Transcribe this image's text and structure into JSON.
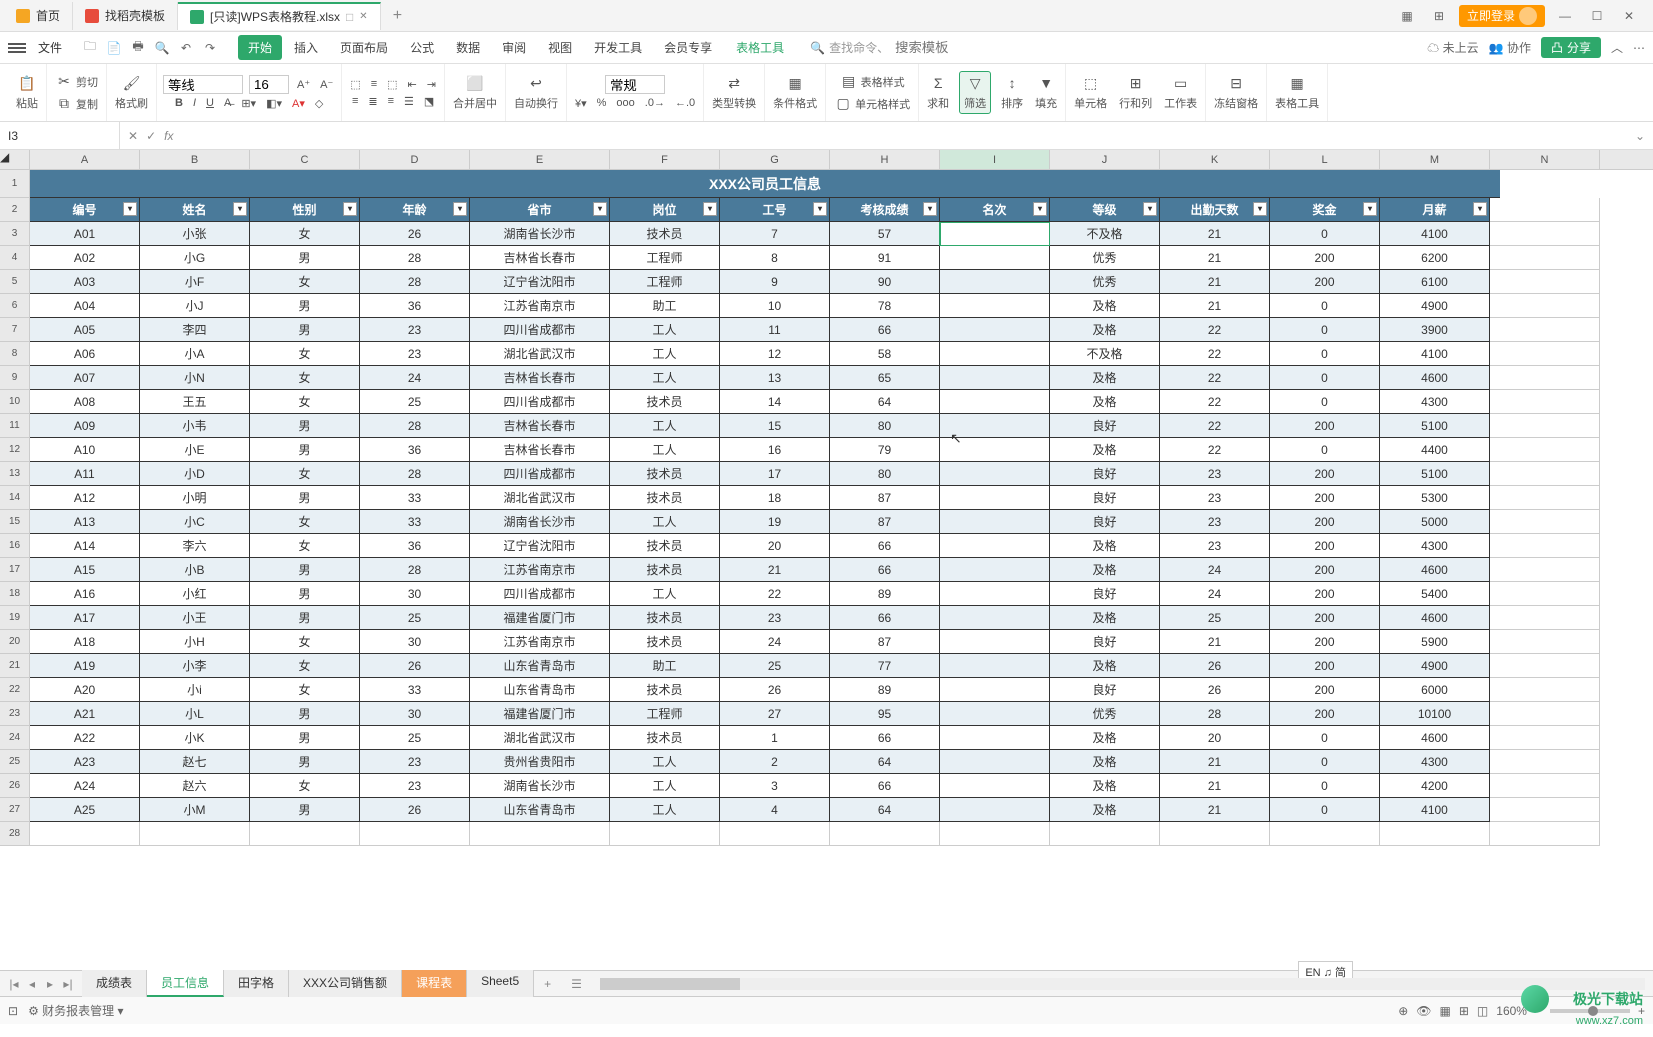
{
  "topTabs": [
    {
      "label": "首页",
      "icon": "home"
    },
    {
      "label": "找稻壳模板",
      "icon": "doc"
    },
    {
      "label": "[只读]WPS表格教程.xlsx",
      "icon": "sheet",
      "active": true,
      "badge": "□"
    }
  ],
  "login": "立即登录",
  "fileMenu": "文件",
  "menuTabs": [
    "开始",
    "插入",
    "页面布局",
    "公式",
    "数据",
    "审阅",
    "视图",
    "开发工具",
    "会员专享"
  ],
  "menuSpecial": "表格工具",
  "searchHint": "查找命令、",
  "searchPlaceholder": "搜索模板",
  "cloud": "未上云",
  "collab": "协作",
  "share": "分享",
  "clipboard": {
    "paste": "粘贴",
    "cut": "剪切",
    "copy": "复制",
    "format": "格式刷"
  },
  "font": {
    "name": "等线",
    "size": "16"
  },
  "fmt": {
    "B": "B",
    "I": "I",
    "U": "U"
  },
  "align": {
    "merge": "合并居中",
    "wrap": "自动换行"
  },
  "number": {
    "fmt": "常规",
    "type": "类型转换"
  },
  "cond": "条件格式",
  "tablefmt": "表格样式",
  "cellfmt": "单元格样式",
  "calc": "求和",
  "filter": "筛选",
  "sort": "排序",
  "fill": "填充",
  "cell": "单元格",
  "rowcol": "行和列",
  "sheet": "工作表",
  "freeze": "冻结窗格",
  "tools": "表格工具",
  "cellRef": "I3",
  "fx": "fx",
  "title": "XXX公司员工信息",
  "headers": [
    "编号",
    "姓名",
    "性别",
    "年龄",
    "省市",
    "岗位",
    "工号",
    "考核成绩",
    "名次",
    "等级",
    "出勤天数",
    "奖金",
    "月薪"
  ],
  "colLetters": [
    "A",
    "B",
    "C",
    "D",
    "E",
    "F",
    "G",
    "H",
    "I",
    "J",
    "K",
    "L",
    "M",
    "N"
  ],
  "rows": [
    [
      "A01",
      "小张",
      "女",
      "26",
      "湖南省长沙市",
      "技术员",
      "7",
      "57",
      "",
      "不及格",
      "21",
      "0",
      "4100"
    ],
    [
      "A02",
      "小G",
      "男",
      "28",
      "吉林省长春市",
      "工程师",
      "8",
      "91",
      "",
      "优秀",
      "21",
      "200",
      "6200"
    ],
    [
      "A03",
      "小F",
      "女",
      "28",
      "辽宁省沈阳市",
      "工程师",
      "9",
      "90",
      "",
      "优秀",
      "21",
      "200",
      "6100"
    ],
    [
      "A04",
      "小J",
      "男",
      "36",
      "江苏省南京市",
      "助工",
      "10",
      "78",
      "",
      "及格",
      "21",
      "0",
      "4900"
    ],
    [
      "A05",
      "李四",
      "男",
      "23",
      "四川省成都市",
      "工人",
      "11",
      "66",
      "",
      "及格",
      "22",
      "0",
      "3900"
    ],
    [
      "A06",
      "小A",
      "女",
      "23",
      "湖北省武汉市",
      "工人",
      "12",
      "58",
      "",
      "不及格",
      "22",
      "0",
      "4100"
    ],
    [
      "A07",
      "小N",
      "女",
      "24",
      "吉林省长春市",
      "工人",
      "13",
      "65",
      "",
      "及格",
      "22",
      "0",
      "4600"
    ],
    [
      "A08",
      "王五",
      "女",
      "25",
      "四川省成都市",
      "技术员",
      "14",
      "64",
      "",
      "及格",
      "22",
      "0",
      "4300"
    ],
    [
      "A09",
      "小韦",
      "男",
      "28",
      "吉林省长春市",
      "工人",
      "15",
      "80",
      "",
      "良好",
      "22",
      "200",
      "5100"
    ],
    [
      "A10",
      "小E",
      "男",
      "36",
      "吉林省长春市",
      "工人",
      "16",
      "79",
      "",
      "及格",
      "22",
      "0",
      "4400"
    ],
    [
      "A11",
      "小D",
      "女",
      "28",
      "四川省成都市",
      "技术员",
      "17",
      "80",
      "",
      "良好",
      "23",
      "200",
      "5100"
    ],
    [
      "A12",
      "小明",
      "男",
      "33",
      "湖北省武汉市",
      "技术员",
      "18",
      "87",
      "",
      "良好",
      "23",
      "200",
      "5300"
    ],
    [
      "A13",
      "小C",
      "女",
      "33",
      "湖南省长沙市",
      "工人",
      "19",
      "87",
      "",
      "良好",
      "23",
      "200",
      "5000"
    ],
    [
      "A14",
      "李六",
      "女",
      "36",
      "辽宁省沈阳市",
      "技术员",
      "20",
      "66",
      "",
      "及格",
      "23",
      "200",
      "4300"
    ],
    [
      "A15",
      "小B",
      "男",
      "28",
      "江苏省南京市",
      "技术员",
      "21",
      "66",
      "",
      "及格",
      "24",
      "200",
      "4600"
    ],
    [
      "A16",
      "小红",
      "男",
      "30",
      "四川省成都市",
      "工人",
      "22",
      "89",
      "",
      "良好",
      "24",
      "200",
      "5400"
    ],
    [
      "A17",
      "小王",
      "男",
      "25",
      "福建省厦门市",
      "技术员",
      "23",
      "66",
      "",
      "及格",
      "25",
      "200",
      "4600"
    ],
    [
      "A18",
      "小H",
      "女",
      "30",
      "江苏省南京市",
      "技术员",
      "24",
      "87",
      "",
      "良好",
      "21",
      "200",
      "5900"
    ],
    [
      "A19",
      "小李",
      "女",
      "26",
      "山东省青岛市",
      "助工",
      "25",
      "77",
      "",
      "及格",
      "26",
      "200",
      "4900"
    ],
    [
      "A20",
      "小i",
      "女",
      "33",
      "山东省青岛市",
      "技术员",
      "26",
      "89",
      "",
      "良好",
      "26",
      "200",
      "6000"
    ],
    [
      "A21",
      "小L",
      "男",
      "30",
      "福建省厦门市",
      "工程师",
      "27",
      "95",
      "",
      "优秀",
      "28",
      "200",
      "10100"
    ],
    [
      "A22",
      "小K",
      "男",
      "25",
      "湖北省武汉市",
      "技术员",
      "1",
      "66",
      "",
      "及格",
      "20",
      "0",
      "4600"
    ],
    [
      "A23",
      "赵七",
      "男",
      "23",
      "贵州省贵阳市",
      "工人",
      "2",
      "64",
      "",
      "及格",
      "21",
      "0",
      "4300"
    ],
    [
      "A24",
      "赵六",
      "女",
      "23",
      "湖南省长沙市",
      "工人",
      "3",
      "66",
      "",
      "及格",
      "21",
      "0",
      "4200"
    ],
    [
      "A25",
      "小M",
      "男",
      "26",
      "山东省青岛市",
      "工人",
      "4",
      "64",
      "",
      "及格",
      "21",
      "0",
      "4100"
    ]
  ],
  "sheetTabs": [
    {
      "label": "成绩表"
    },
    {
      "label": "员工信息",
      "active": true
    },
    {
      "label": "田字格"
    },
    {
      "label": "XXX公司销售额"
    },
    {
      "label": "课程表",
      "orange": true
    },
    {
      "label": "Sheet5"
    }
  ],
  "lang": "EN ♫ 简",
  "statusTask": "财务报表管理",
  "zoom": "160%",
  "watermark": "极光下载站",
  "watermarkUrl": "www.xz7.com"
}
